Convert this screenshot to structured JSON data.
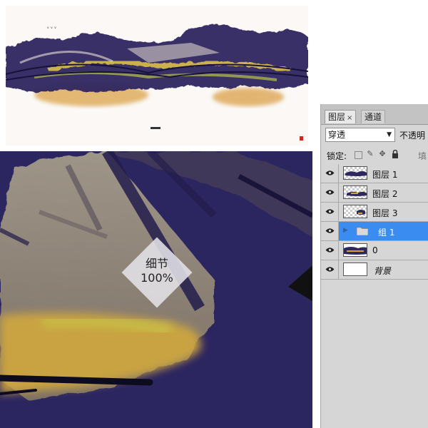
{
  "preview": {
    "name": "landscape-preview"
  },
  "zoom": {
    "detail_label": "细节",
    "detail_value": "100%"
  },
  "panel": {
    "tabs": [
      {
        "label": "图层",
        "close": "×",
        "active": true
      },
      {
        "label": "通道",
        "active": false
      }
    ],
    "blend_mode": "穿透",
    "opacity_label": "不透明",
    "lock_label": "锁定:",
    "lock_icons": [
      "transparency-lock-icon",
      "brush-lock-icon",
      "move-lock-icon",
      "padlock-icon"
    ],
    "fill_label": "填",
    "layers": [
      {
        "name": "图层 1",
        "type": "layer",
        "selected": false
      },
      {
        "name": "图层 2",
        "type": "layer",
        "selected": false
      },
      {
        "name": "图层 3",
        "type": "layer",
        "selected": false
      },
      {
        "name": "组 1",
        "type": "group",
        "selected": true
      },
      {
        "name": "0",
        "type": "layer",
        "selected": false
      },
      {
        "name": "背景",
        "type": "background",
        "selected": false
      }
    ]
  },
  "colors": {
    "accent": "#3a8cf0",
    "indigo": "#2c2660",
    "ochre": "#d9a13a"
  }
}
